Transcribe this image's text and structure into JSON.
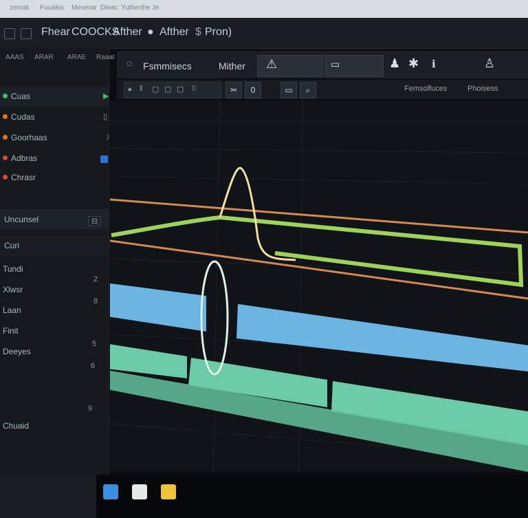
{
  "browser_tabs": [
    "zeroat",
    "Fuuakis",
    "Meverar",
    "Dleac",
    "Yuthenhe Je"
  ],
  "menu": {
    "items": [
      "Fhear",
      "COOCKS",
      "Afther",
      "Afther",
      "Pron)"
    ]
  },
  "sidebar": {
    "tabs": [
      "AAAS",
      "ARAR",
      "ARAE",
      "Raaat"
    ],
    "items": [
      "Cuas",
      "Cudas",
      "Goorhaas",
      "Adbras",
      "Chrasr"
    ],
    "section1": "Uncunsel",
    "section2": "Curi",
    "items2": [
      "Tundi",
      "Xlwsr",
      "Laan",
      "Finit",
      "Deeyes"
    ],
    "bottom_label": "Chuaid",
    "colors": {
      "green": "#3fbf5f",
      "orange": "#e0762e",
      "red": "#d9483a",
      "blue": "#2b73d6"
    }
  },
  "panel": {
    "title": "Fsmmisecs",
    "label": "Mither",
    "right_labels": [
      "Femsolfuces",
      "Phoisess"
    ]
  },
  "timeline": {
    "colors": {
      "orange": "#d88a4c",
      "green": "#9fd25a",
      "curve": "#f3e0a0",
      "blue": "#6cb4e2",
      "teal": "#6ccca8",
      "ellipse": "#dff1e4"
    }
  }
}
